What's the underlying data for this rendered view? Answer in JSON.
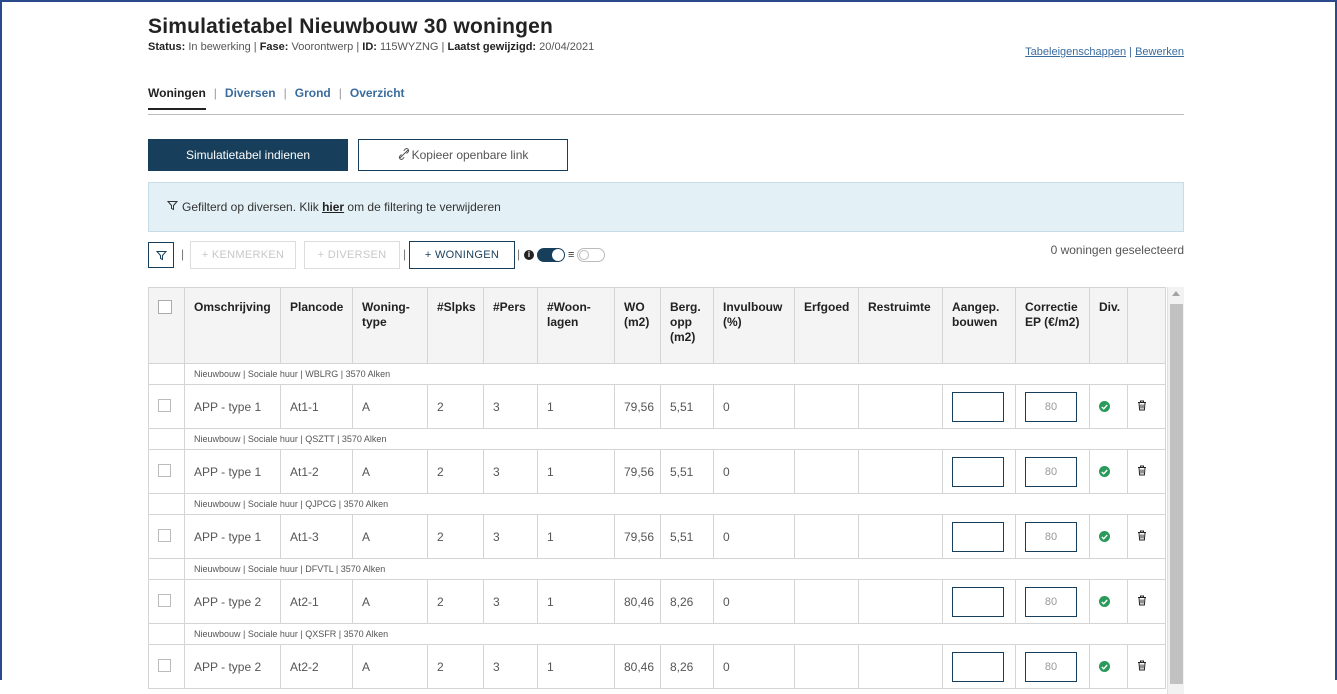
{
  "page": {
    "title": "Simulatietabel Nieuwbouw 30 woningen",
    "meta": {
      "status_label": "Status:",
      "status_value": "In bewerking",
      "fase_label": "Fase:",
      "fase_value": "Voorontwerp",
      "id_label": "ID:",
      "id_value": "115WYZNG",
      "gewijzigd_label": "Laatst gewijzigd:",
      "gewijzigd_value": "20/04/2021",
      "sep": " | "
    },
    "links": {
      "tabeleigenschappen": "Tabeleigenschappen",
      "sep": " | ",
      "bewerken": "Bewerken"
    }
  },
  "tabs": [
    {
      "label": "Woningen",
      "active": true
    },
    {
      "label": "Diversen",
      "active": false
    },
    {
      "label": "Grond",
      "active": false
    },
    {
      "label": "Overzicht",
      "active": false
    }
  ],
  "tab_sep": "|",
  "actions": {
    "submit": "Simulatietabel indienen",
    "copy_icon": "link-icon",
    "copy_link": "Kopieer openbare link"
  },
  "filter_notice": {
    "icon": "filter-icon",
    "text_before": "Gefilterd op diversen. Klik ",
    "link": "hier",
    "text_after": " om de filtering te verwijderen"
  },
  "toolbar": {
    "filter_icon": "filter-icon",
    "kenmerken": "+ KENMERKEN",
    "diversen": "+ DIVERSEN",
    "woningen": "+ WONINGEN",
    "sep": "|",
    "selected_count": "0 woningen geselecteerd"
  },
  "table": {
    "headers": [
      "Omschrijving",
      "Plancode",
      "Woning-type",
      "#Slpks",
      "#Pers",
      "#Woon-lagen",
      "WO (m2)",
      "Berg. opp (m2)",
      "Invulbouw (%)",
      "Erfgoed",
      "Restruimte",
      "Aangep. bouwen",
      "Correctie EP (€/m2)",
      "Div."
    ],
    "groups": [
      {
        "label": "Nieuwbouw | Sociale huur | WBLRG | 3570 Alken",
        "row": {
          "omschrijving": "APP - type 1",
          "plancode": "At1-1",
          "type": "A",
          "slpks": "2",
          "pers": "3",
          "woonlagen": "1",
          "wo": "79,56",
          "berg": "5,51",
          "invul": "0",
          "erfgoed": "",
          "restruimte": "",
          "aangep": "",
          "correctie": "80"
        }
      },
      {
        "label": "Nieuwbouw | Sociale huur | QSZTT | 3570 Alken",
        "row": {
          "omschrijving": "APP - type 1",
          "plancode": "At1-2",
          "type": "A",
          "slpks": "2",
          "pers": "3",
          "woonlagen": "1",
          "wo": "79,56",
          "berg": "5,51",
          "invul": "0",
          "erfgoed": "",
          "restruimte": "",
          "aangep": "",
          "correctie": "80"
        }
      },
      {
        "label": "Nieuwbouw | Sociale huur | QJPCG | 3570 Alken",
        "row": {
          "omschrijving": "APP - type 1",
          "plancode": "At1-3",
          "type": "A",
          "slpks": "2",
          "pers": "3",
          "woonlagen": "1",
          "wo": "79,56",
          "berg": "5,51",
          "invul": "0",
          "erfgoed": "",
          "restruimte": "",
          "aangep": "",
          "correctie": "80"
        }
      },
      {
        "label": "Nieuwbouw | Sociale huur | DFVTL | 3570 Alken",
        "row": {
          "omschrijving": "APP - type 2",
          "plancode": "At2-1",
          "type": "A",
          "slpks": "2",
          "pers": "3",
          "woonlagen": "1",
          "wo": "80,46",
          "berg": "8,26",
          "invul": "0",
          "erfgoed": "",
          "restruimte": "",
          "aangep": "",
          "correctie": "80"
        }
      },
      {
        "label": "Nieuwbouw | Sociale huur | QXSFR | 3570 Alken",
        "row": {
          "omschrijving": "APP - type 2",
          "plancode": "At2-2",
          "type": "A",
          "slpks": "2",
          "pers": "3",
          "woonlagen": "1",
          "wo": "80,46",
          "berg": "8,26",
          "invul": "0",
          "erfgoed": "",
          "restruimte": "",
          "aangep": "",
          "correctie": "80"
        }
      }
    ],
    "status_icon": "check-circle-icon",
    "delete_icon": "trash-icon"
  },
  "colors": {
    "primary": "#173e5a",
    "link": "#3b6c9e",
    "ok": "#2a9a5b",
    "filter_bg": "#e3f0f5"
  }
}
